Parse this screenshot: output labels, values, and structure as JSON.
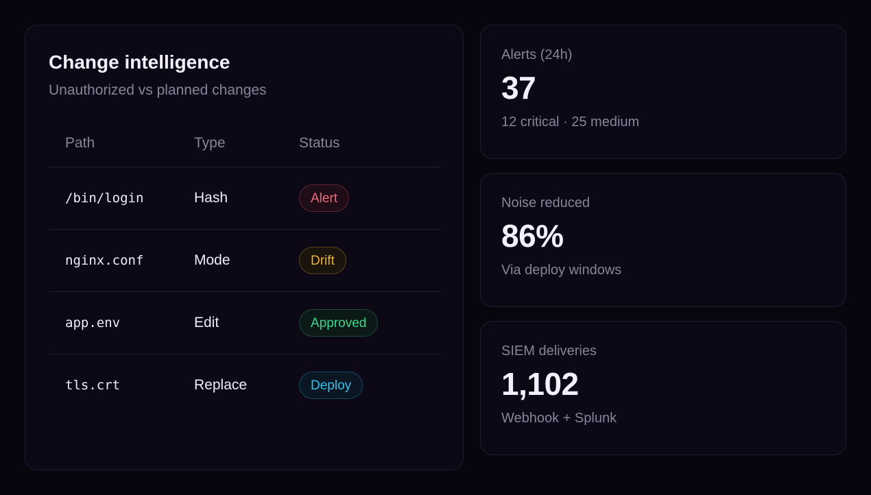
{
  "change_panel": {
    "title": "Change intelligence",
    "subtitle": "Unauthorized vs planned changes",
    "columns": [
      "Path",
      "Type",
      "Status"
    ],
    "rows": [
      {
        "path": "/bin/login",
        "type": "Hash",
        "status": "Alert",
        "status_color": "#f06b7a"
      },
      {
        "path": "nginx.conf",
        "type": "Mode",
        "status": "Drift",
        "status_color": "#ecb33a"
      },
      {
        "path": "app.env",
        "type": "Edit",
        "status": "Approved",
        "status_color": "#3fd68e"
      },
      {
        "path": "tls.crt",
        "type": "Replace",
        "status": "Deploy",
        "status_color": "#35c3ee"
      }
    ]
  },
  "stats": [
    {
      "label": "Alerts (24h)",
      "value": "37",
      "sub": "12 critical · 25 medium"
    },
    {
      "label": "Noise reduced",
      "value": "86%",
      "sub": "Via deploy windows"
    },
    {
      "label": "SIEM deliveries",
      "value": "1,102",
      "sub": "Webhook + Splunk"
    }
  ],
  "colors": {
    "background": "#07050d",
    "card": "#0c0816",
    "border": "#221d33",
    "muted_text": "#8a8499"
  }
}
